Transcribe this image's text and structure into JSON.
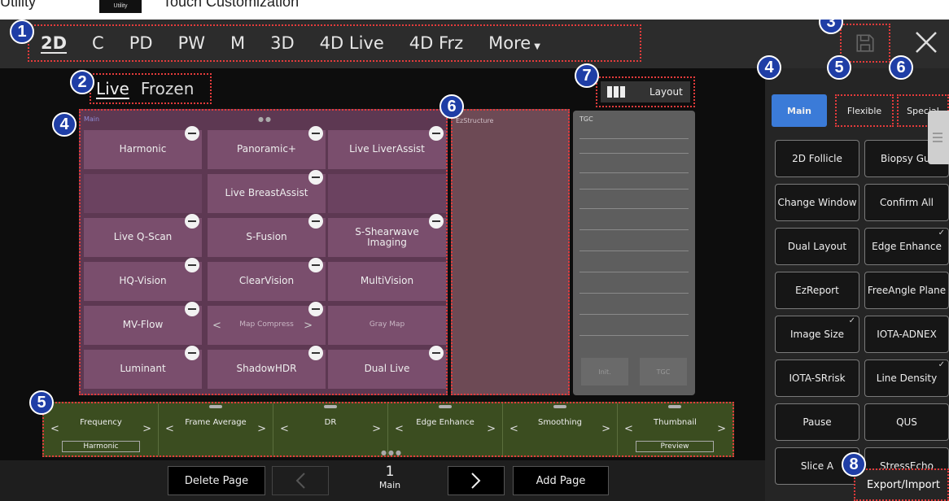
{
  "doc_header": {
    "utility_label": "Utility",
    "utility_badge": "Utility",
    "touch_label": "Touch Customization"
  },
  "modes": [
    "2D",
    "C",
    "PD",
    "PW",
    "M",
    "3D",
    "4D Live",
    "4D Frz",
    "More"
  ],
  "live_frozen": [
    "Live",
    "Frozen"
  ],
  "layout_label": "Layout",
  "main_area": {
    "label": "Main",
    "cells": [
      "Harmonic",
      "Panoramic+",
      "Live LiverAssist",
      "",
      "Live BreastAssist",
      "",
      "Live Q-Scan",
      "S-Fusion",
      "S-Shearwave Imaging",
      "HQ-Vision",
      "ClearVision",
      "MultiVision",
      "MV-Flow",
      "Map Compress",
      "Gray Map",
      "Luminant",
      "ShadowHDR",
      "Dual Live"
    ]
  },
  "ez_label": "EzStructure",
  "tgc": {
    "label": "TGC",
    "btn_init": "Init.",
    "btn_tgc": "TGC"
  },
  "function_keys": [
    {
      "name": "Frequency",
      "sub": "Harmonic"
    },
    {
      "name": "Frame Average",
      "sub": ""
    },
    {
      "name": "DR",
      "sub": ""
    },
    {
      "name": "Edge Enhance",
      "sub": ""
    },
    {
      "name": "Smoothing",
      "sub": ""
    },
    {
      "name": "Thumbnail",
      "sub": "Preview"
    }
  ],
  "bottom": {
    "delete_page": "Delete Page",
    "page_number": "1",
    "page_name": "Main",
    "add_page": "Add Page"
  },
  "right_tabs": [
    "Main",
    "Flexible",
    "Special"
  ],
  "right_buttons": [
    "2D Follicle",
    "Biopsy Gui",
    "Change Window",
    "Confirm All",
    "Dual Layout",
    "Edge Enhance",
    "EzReport",
    "FreeAngle Plane",
    "Image Size",
    "IOTA-ADNEX",
    "IOTA-SRrisk",
    "Line Density",
    "Pause",
    "QUS",
    "Slice A",
    "StressEcho"
  ],
  "export_import": "Export/Import",
  "badges": [
    "1",
    "2",
    "3",
    "4",
    "4",
    "5",
    "5",
    "6",
    "6",
    "7",
    "8"
  ],
  "colors": {
    "accent": "#3b7bd8",
    "badge": "#1f3ea6",
    "highlight_border": "#e53b3b"
  }
}
